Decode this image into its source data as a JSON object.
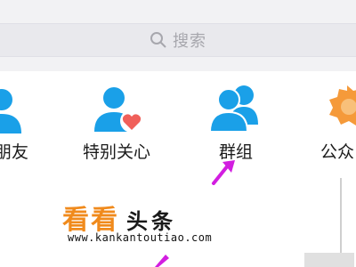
{
  "search": {
    "placeholder": "搜索",
    "icon": "search-icon"
  },
  "items": [
    {
      "label": "朋友",
      "icon": "person-icon"
    },
    {
      "label": "特别关心",
      "icon": "person-heart-icon"
    },
    {
      "label": "群组",
      "icon": "group-icon"
    },
    {
      "label": "公众",
      "icon": "badge-icon"
    }
  ],
  "watermark": {
    "brand_orange": "看看",
    "brand_black": "头条",
    "url": "www.kankantoutiao.com"
  },
  "colors": {
    "accent_blue": "#1aa0e8",
    "heart_red": "#f0605a",
    "annotation_magenta": "#d21ee0",
    "watermark_orange": "#f08a1c",
    "badge_orange": "#f59a3a"
  }
}
